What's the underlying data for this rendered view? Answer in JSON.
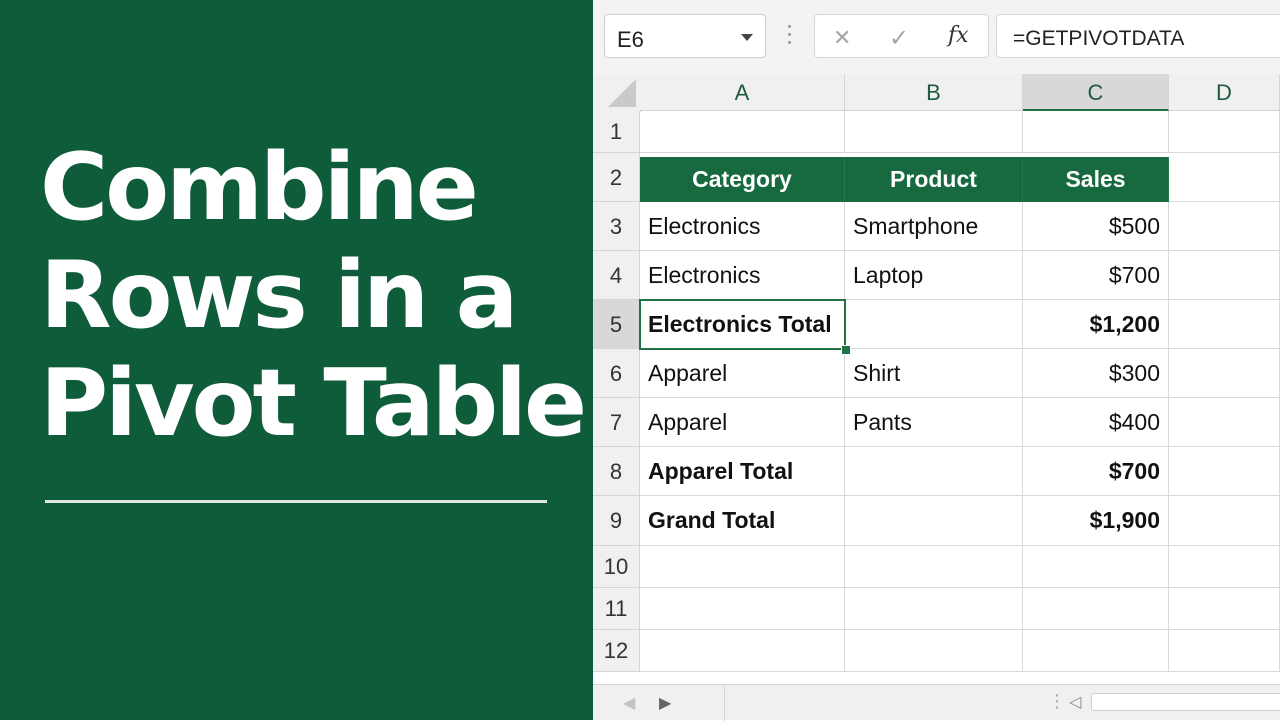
{
  "headline": {
    "lines": [
      "Combine",
      "Rows in a",
      "Pivot Table"
    ]
  },
  "formula_bar": {
    "name_box": "E6",
    "formula": "=GETPIVOTDATA",
    "fx_label": "fx"
  },
  "grid": {
    "columns": [
      "A",
      "B",
      "C",
      "D"
    ],
    "active_column": "C",
    "rows": [
      "1",
      "2",
      "3",
      "4",
      "5",
      "6",
      "7",
      "8",
      "9",
      "10",
      "11",
      "12"
    ],
    "active_row": "5",
    "table_headers": [
      "Category",
      "Product",
      "Sales"
    ],
    "table_rows": [
      {
        "category": "Electronics",
        "product": "Smartphone",
        "sales": "$500",
        "bold": false
      },
      {
        "category": "Electronics",
        "product": "Laptop",
        "sales": "$700",
        "bold": false
      },
      {
        "category": "Electronics Total",
        "product": "",
        "sales": "$1,200",
        "bold": true
      },
      {
        "category": "Apparel",
        "product": "Shirt",
        "sales": "$300",
        "bold": false
      },
      {
        "category": "Apparel",
        "product": "Pants",
        "sales": "$400",
        "bold": false
      },
      {
        "category": "Apparel Total",
        "product": "",
        "sales": "$700",
        "bold": true
      },
      {
        "category": "Grand Total",
        "product": "",
        "sales": "$1,900",
        "bold": true
      }
    ]
  },
  "colors": {
    "panel_green": "#0f5c3a",
    "header_green": "#176a3f",
    "accent": "#217346"
  }
}
